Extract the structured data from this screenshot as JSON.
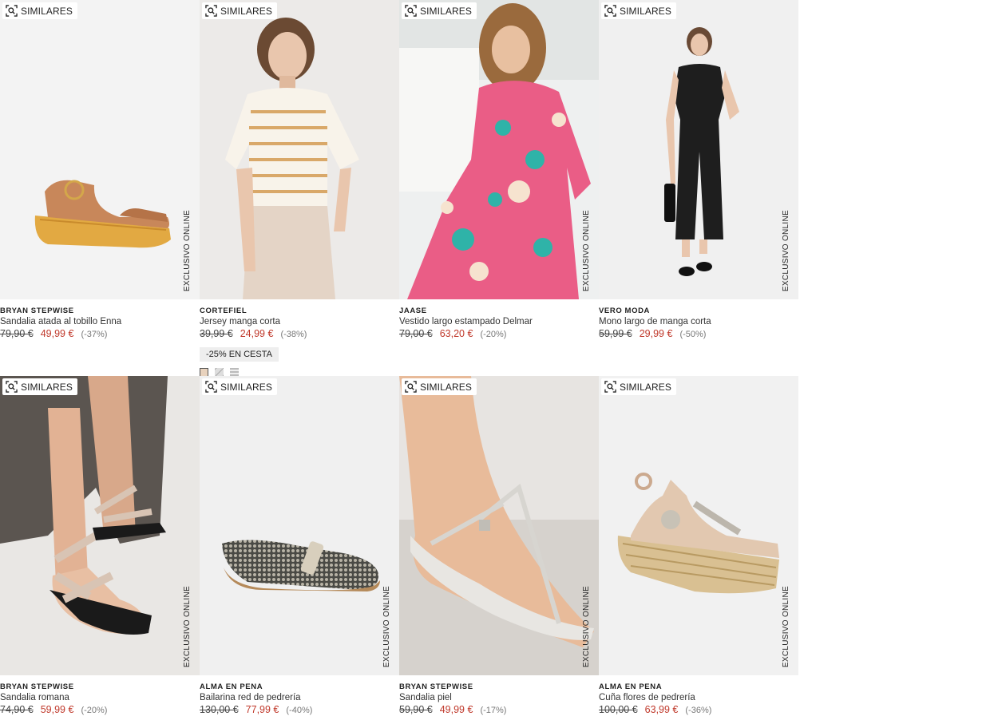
{
  "similar_label": "SIMILARES",
  "exclusive_label": "EXCLUSIVO ONLINE",
  "products": [
    {
      "brand": "BRYAN STEPWISE",
      "name": "Sandalia atada al tobillo Enna",
      "old_price": "79,90 €",
      "new_price": "49,99 €",
      "discount": "(-37%)"
    },
    {
      "brand": "CORTEFIEL",
      "name": "Jersey manga corta",
      "old_price": "39,99 €",
      "new_price": "24,99 €",
      "discount": "(-38%)",
      "promo": "-25% EN CESTA"
    },
    {
      "brand": "JAASE",
      "name": "Vestido largo estampado Delmar",
      "old_price": "79,00 €",
      "new_price": "63,20 €",
      "discount": "(-20%)"
    },
    {
      "brand": "VERO MODA",
      "name": "Mono largo de manga corta",
      "old_price": "59,99 €",
      "new_price": "29,99 €",
      "discount": "(-50%)"
    },
    {
      "brand": "BRYAN STEPWISE",
      "name": "Sandalia romana",
      "old_price": "74,90 €",
      "new_price": "59,99 €",
      "discount": "(-20%)"
    },
    {
      "brand": "ALMA EN PENA",
      "name": "Bailarina red de pedrería",
      "old_price": "130,00 €",
      "new_price": "77,99 €",
      "discount": "(-40%)"
    },
    {
      "brand": "BRYAN STEPWISE",
      "name": "Sandalia piel",
      "old_price": "59,90 €",
      "new_price": "49,99 €",
      "discount": "(-17%)"
    },
    {
      "brand": "ALMA EN PENA",
      "name": "Cuña flores de pedrería",
      "old_price": "100,00 €",
      "new_price": "63,99 €",
      "discount": "(-36%)"
    }
  ],
  "colors": {
    "sale": "#c0392b",
    "promo_bg": "#eeeeee"
  }
}
